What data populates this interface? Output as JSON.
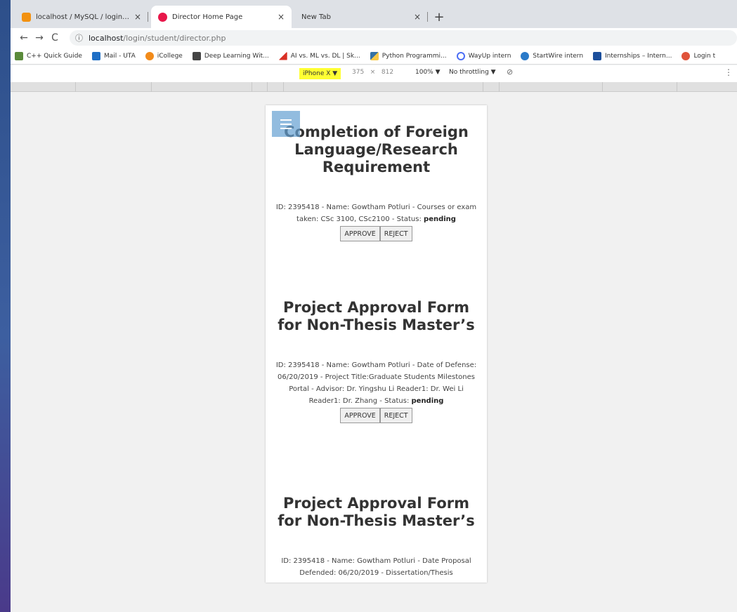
{
  "tabs": [
    {
      "title": "localhost / MySQL / login / comp",
      "close": "×",
      "color": "#f29111"
    },
    {
      "title": "Director Home Page",
      "close": "×",
      "color": "#e8174a"
    },
    {
      "title": "New Tab",
      "close": "×",
      "color": "#ffffff"
    }
  ],
  "new_tab": "+",
  "address": {
    "host": "localhost",
    "path": "/login/student/director.php",
    "info_icon": "ⓘ"
  },
  "bookmarks": [
    {
      "label": "C++ Quick Guide",
      "color": "#5a8a3a"
    },
    {
      "label": "Mail - UTA",
      "color": "#1f6fc5"
    },
    {
      "label": "iCollege",
      "color": "#f28b1a"
    },
    {
      "label": "Deep Learning Wit...",
      "color": "#444444"
    },
    {
      "label": "AI vs. ML vs. DL | Sk...",
      "color": "#d93025"
    },
    {
      "label": "Python Programmi...",
      "color": "#3572a5"
    },
    {
      "label": "WayUp intern",
      "color": "#4c6ef5"
    },
    {
      "label": "StartWire intern",
      "color": "#2a7ac9"
    },
    {
      "label": "Internships – Intern...",
      "color": "#1c4f9c"
    },
    {
      "label": "Login t",
      "color": "#e0533a"
    }
  ],
  "device_toolbar": {
    "device": "iPhone X ▼",
    "width": "375",
    "times": "×",
    "height": "812",
    "zoom": "100% ▼",
    "throttle": "No throttling ▼",
    "rotate_icon": "⃠",
    "more": "⋮"
  },
  "sections": [
    {
      "title": "Completion of Foreign Language/Research Requirement",
      "text": "ID: 2395418 - Name: Gowtham Potluri - Courses or exam taken: CSc 3100, CSc2100 - Status: ",
      "status": "pending",
      "approve": "APPROVE",
      "reject": "REJECT"
    },
    {
      "title": "Project Approval Form for Non-Thesis Master’s",
      "text": "ID: 2395418 - Name: Gowtham Potluri - Date of Defense: 06/20/2019 - Project Title:Graduate Students Milestones Portal - Advisor: Dr. Yingshu Li Reader1: Dr. Wei Li Reader1: Dr. Zhang - Status: ",
      "status": "pending",
      "approve": "APPROVE",
      "reject": "REJECT"
    },
    {
      "title": "Project Approval Form for Non-Thesis Master’s",
      "text": "ID: 2395418 - Name: Gowtham Potluri - Date Proposal Defended: 06/20/2019 - Dissertation/Thesis"
    }
  ]
}
